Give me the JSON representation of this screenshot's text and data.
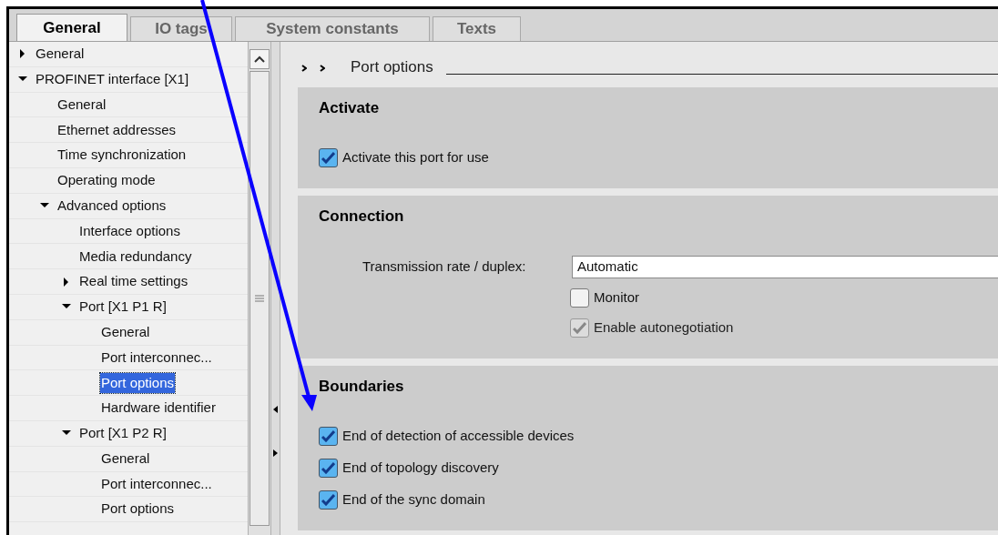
{
  "tabs": [
    {
      "label": "General",
      "selected": true
    },
    {
      "label": "IO tags",
      "selected": false
    },
    {
      "label": "System constants",
      "selected": false
    },
    {
      "label": "Texts",
      "selected": false
    }
  ],
  "tree": [
    {
      "label": "General",
      "expanded": false,
      "selected": false
    },
    {
      "label": "PROFINET interface [X1]",
      "expanded": true,
      "selected": false,
      "children": [
        {
          "label": "General",
          "selected": false
        },
        {
          "label": "Ethernet addresses",
          "selected": false
        },
        {
          "label": "Time synchronization",
          "selected": false
        },
        {
          "label": "Operating mode",
          "selected": false
        },
        {
          "label": "Advanced options",
          "expanded": true,
          "selected": false,
          "children": [
            {
              "label": "Interface options",
              "selected": false
            },
            {
              "label": "Media redundancy",
              "selected": false
            },
            {
              "label": "Real time settings",
              "expanded": false,
              "selected": false
            },
            {
              "label": "Port [X1 P1 R]",
              "expanded": true,
              "selected": false,
              "children": [
                {
                  "label": "General",
                  "selected": false
                },
                {
                  "label": "Port interconnec...",
                  "selected": false
                },
                {
                  "label": "Port options",
                  "selected": true
                },
                {
                  "label": "Hardware identifier",
                  "selected": false
                }
              ]
            },
            {
              "label": "Port [X1 P2 R]",
              "expanded": true,
              "selected": false,
              "children": [
                {
                  "label": "General",
                  "selected": false
                },
                {
                  "label": "Port interconnec...",
                  "selected": false
                },
                {
                  "label": "Port options",
                  "selected": false
                }
              ]
            }
          ]
        }
      ]
    }
  ],
  "breadcrumb": "Port options",
  "sections": [
    {
      "title": "Activate",
      "items": [
        {
          "kind": "checkbox",
          "label": "Activate this port for use",
          "checked": true,
          "disabled": false
        }
      ]
    },
    {
      "title": "Connection",
      "items": [
        {
          "kind": "field",
          "label": "Transmission rate / duplex:",
          "value": "Automatic"
        },
        {
          "kind": "checkbox",
          "label": "Monitor",
          "checked": false,
          "disabled": false,
          "indented": true
        },
        {
          "kind": "checkbox",
          "label": "Enable autonegotiation",
          "checked": true,
          "disabled": true,
          "indented": true
        }
      ]
    },
    {
      "title": "Boundaries",
      "items": [
        {
          "kind": "checkbox",
          "label": "End of detection of accessible devices",
          "checked": true,
          "disabled": false
        },
        {
          "kind": "checkbox",
          "label": "End of topology discovery",
          "checked": true,
          "disabled": false
        },
        {
          "kind": "checkbox",
          "label": "End of the sync domain",
          "checked": true,
          "disabled": false
        }
      ]
    }
  ]
}
